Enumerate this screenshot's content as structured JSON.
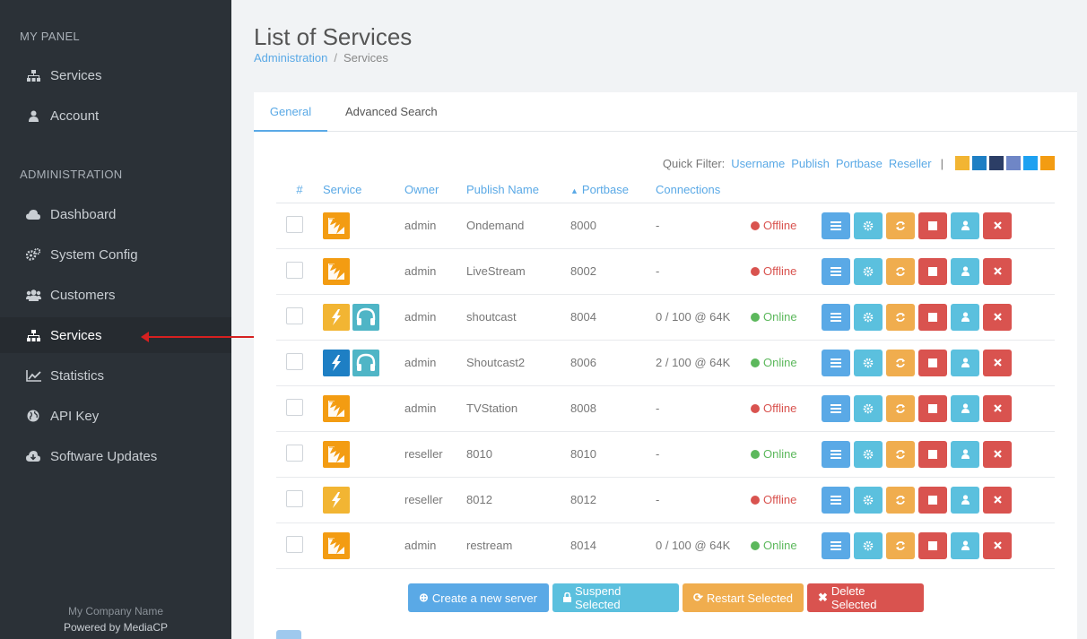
{
  "sidebar": {
    "section_panel": "MY PANEL",
    "panel_items": [
      {
        "label": "Services",
        "icon": "sitemap-icon"
      },
      {
        "label": "Account",
        "icon": "user-icon"
      }
    ],
    "section_admin": "ADMINISTRATION",
    "admin_items": [
      {
        "label": "Dashboard",
        "icon": "cloud-icon"
      },
      {
        "label": "System Config",
        "icon": "cogs-icon"
      },
      {
        "label": "Customers",
        "icon": "users-icon"
      },
      {
        "label": "Services",
        "icon": "sitemap-icon",
        "active": true
      },
      {
        "label": "Statistics",
        "icon": "line-chart-icon"
      },
      {
        "label": "API Key",
        "icon": "globe-icon"
      },
      {
        "label": "Software Updates",
        "icon": "cloud-download-icon"
      }
    ],
    "footer_company": "My Company Name",
    "footer_powered": "Powered by MediaCP"
  },
  "header": {
    "title": "List of Services",
    "breadcrumb_root": "Administration",
    "breadcrumb_sep": "/",
    "breadcrumb_current": "Services"
  },
  "tabs": [
    "General",
    "Advanced Search"
  ],
  "quick_filter": {
    "label": "Quick Filter:",
    "options": [
      "Username",
      "Publish",
      "Portbase",
      "Reseller"
    ],
    "separator": "|"
  },
  "table": {
    "headers": [
      "#",
      "Service",
      "Owner",
      "Publish Name",
      "Portbase",
      "Connections"
    ],
    "sort_indicator": "▲",
    "rows": [
      {
        "owner": "admin",
        "publish": "Ondemand",
        "port": "8000",
        "conn": "-",
        "status": "Offline",
        "services": [
          "wowza"
        ]
      },
      {
        "owner": "admin",
        "publish": "LiveStream",
        "port": "8002",
        "conn": "-",
        "status": "Offline",
        "services": [
          "wowza"
        ]
      },
      {
        "owner": "admin",
        "publish": "shoutcast",
        "port": "8004",
        "conn": "0 / 100 @ 64K",
        "status": "Online",
        "services": [
          "shoutcast1",
          "headphones"
        ]
      },
      {
        "owner": "admin",
        "publish": "Shoutcast2",
        "port": "8006",
        "conn": "2 / 100 @ 64K",
        "status": "Online",
        "services": [
          "shoutcast2",
          "headphones"
        ]
      },
      {
        "owner": "admin",
        "publish": "TVStation",
        "port": "8008",
        "conn": "-",
        "status": "Offline",
        "services": [
          "wowza"
        ]
      },
      {
        "owner": "reseller",
        "publish": "8010",
        "port": "8010",
        "conn": "-",
        "status": "Online",
        "services": [
          "wowza"
        ]
      },
      {
        "owner": "reseller",
        "publish": "8012",
        "port": "8012",
        "conn": "-",
        "status": "Offline",
        "services": [
          "shoutcast1"
        ]
      },
      {
        "owner": "admin",
        "publish": "restream",
        "port": "8014",
        "conn": "0 / 100 @ 64K",
        "status": "Online",
        "services": [
          "wowza"
        ]
      }
    ]
  },
  "buttons": {
    "create": "Create a new server",
    "suspend": "Suspend Selected",
    "restart": "Restart Selected",
    "delete": "Delete Selected"
  },
  "colors": {
    "sidebar_bg": "#2b3137",
    "link": "#5aa9e6",
    "offline": "#d9534f",
    "online": "#5cb85c",
    "annotation_arrow": "#d62020"
  }
}
